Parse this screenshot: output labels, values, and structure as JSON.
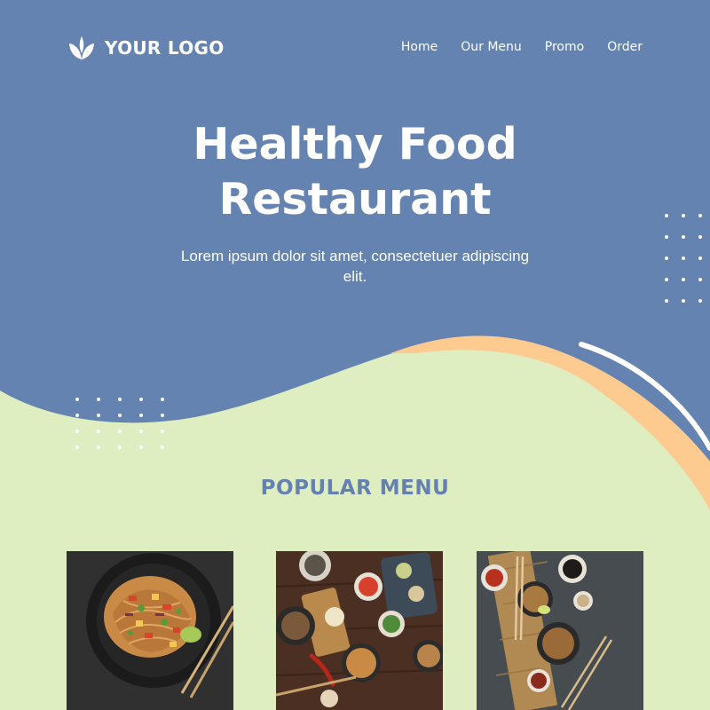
{
  "brand": {
    "logo_text": "YOUR LOGO",
    "logo_icon": "leaf-icon"
  },
  "nav": {
    "items": [
      "Home",
      "Our Menu",
      "Promo",
      "Order"
    ]
  },
  "hero": {
    "title_line1": "Healthy Food",
    "title_line2": "Restaurant",
    "subtitle": "Lorem ipsum dolor sit amet, consectetuer adipiscing elit."
  },
  "section": {
    "title": "POPULAR MENU"
  },
  "menu_items": [
    {
      "image": "noodle-stir-fry-plate"
    },
    {
      "image": "asian-dishes-spread"
    },
    {
      "image": "noodle-bowls-with-sauces"
    }
  ],
  "colors": {
    "hero_blue": "#6583b1",
    "background_green": "#dfeec0",
    "accent_peach": "#fdca8f",
    "title_blue": "#6581b0",
    "text_white": "#ffffff"
  }
}
